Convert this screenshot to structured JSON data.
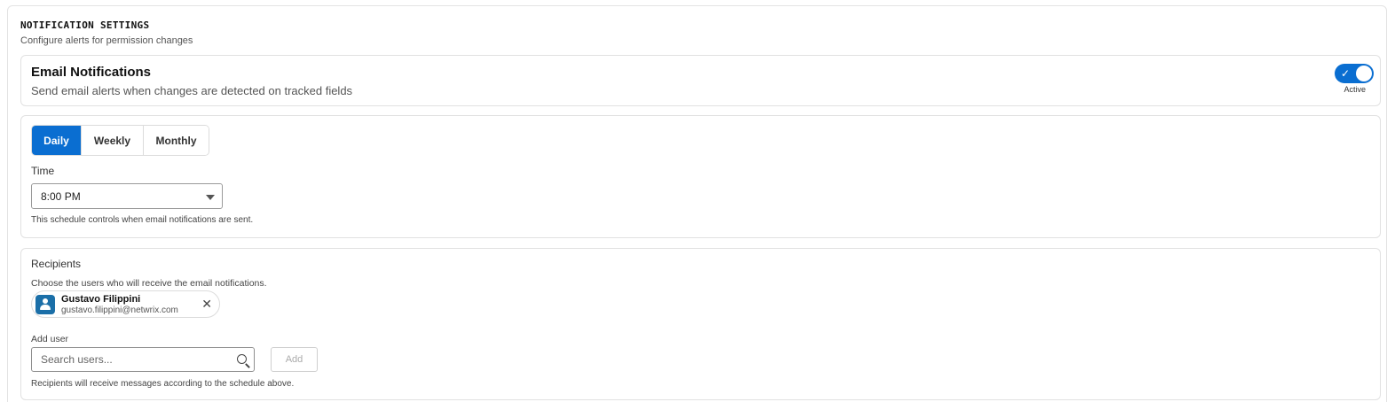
{
  "section": {
    "title": "NOTIFICATION SETTINGS",
    "subtitle": "Configure alerts for permission changes"
  },
  "email": {
    "title": "Email Notifications",
    "description": "Send email alerts when changes are detected on tracked fields",
    "toggle_on": true,
    "toggle_label": "Active",
    "toggle_check": "✓"
  },
  "schedule": {
    "tabs": [
      {
        "label": "Daily",
        "active": true
      },
      {
        "label": "Weekly",
        "active": false
      },
      {
        "label": "Monthly",
        "active": false
      }
    ],
    "time_label": "Time",
    "time_value": "8:00 PM",
    "help": "This schedule controls when email notifications are sent."
  },
  "recipients": {
    "label": "Recipients",
    "help": "Choose the users who will receive the email notifications.",
    "users": [
      {
        "name": "Gustavo Filippini",
        "email": "gustavo.filippini@netwrix.com"
      }
    ],
    "remove_glyph": "✕",
    "add_user_label": "Add user",
    "search_placeholder": "Search users...",
    "add_button": "Add",
    "footer": "Recipients will receive messages according to the schedule above."
  },
  "colors": {
    "accent": "#0a6ed1",
    "avatar": "#1b6fa8"
  }
}
